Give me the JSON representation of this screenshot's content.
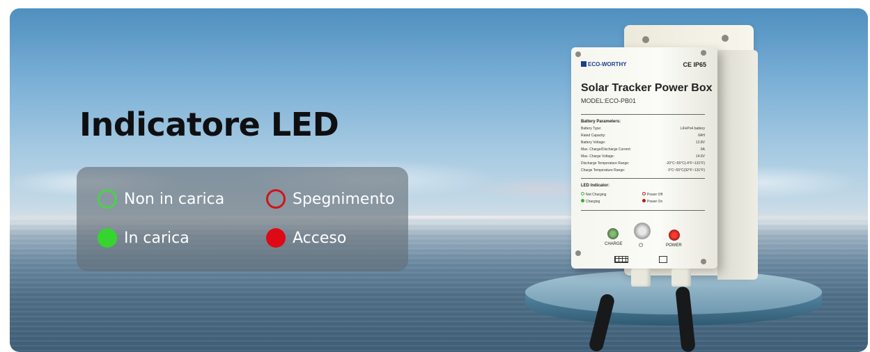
{
  "banner": {
    "title": "Indicatore LED",
    "legend": [
      {
        "label": "Non in carica",
        "style": "ring",
        "color": "#4cd14a"
      },
      {
        "label": "Spegnimento",
        "style": "ring",
        "color": "#d01418"
      },
      {
        "label": "In carica",
        "style": "filled",
        "color": "#37d42f"
      },
      {
        "label": "Acceso",
        "style": "filled",
        "color": "#dd0a16"
      }
    ]
  },
  "product": {
    "brand": "ECO-WORTHY",
    "certifications": "CE IP65",
    "name": "Solar Tracker Power Box",
    "model": "MODEL:ECO-PB01",
    "battery_heading": "Battery Parameters:",
    "specs": [
      {
        "key": "Battery Type:",
        "value": "LiFePo4 battery"
      },
      {
        "key": "Rated Capacity:",
        "value": "6AH"
      },
      {
        "key": "Battery Voltage:",
        "value": "12.8V"
      },
      {
        "key": "Max. Charge/Discharge Current:",
        "value": "6A"
      },
      {
        "key": "Max. Charge Voltage:",
        "value": "14.6V"
      },
      {
        "key": "Discharge Temperature Range:",
        "value": "-20°C~55°C(-4°F~131°F)"
      },
      {
        "key": "Charge Temperature Range:",
        "value": "0°C~55°C(32°F~131°F)"
      }
    ],
    "led_heading": "LED Indicator:",
    "led_legend": {
      "not_charging": "Not Charging",
      "charging": "Charging",
      "power_off": "Power Off",
      "power_on": "Power On"
    },
    "panel_labels": {
      "charge": "CHARGE",
      "power": "POWER",
      "switch_symbol": "⏻"
    },
    "icons": [
      "solar-panel-icon",
      "battery-icon",
      "power-icon"
    ]
  }
}
